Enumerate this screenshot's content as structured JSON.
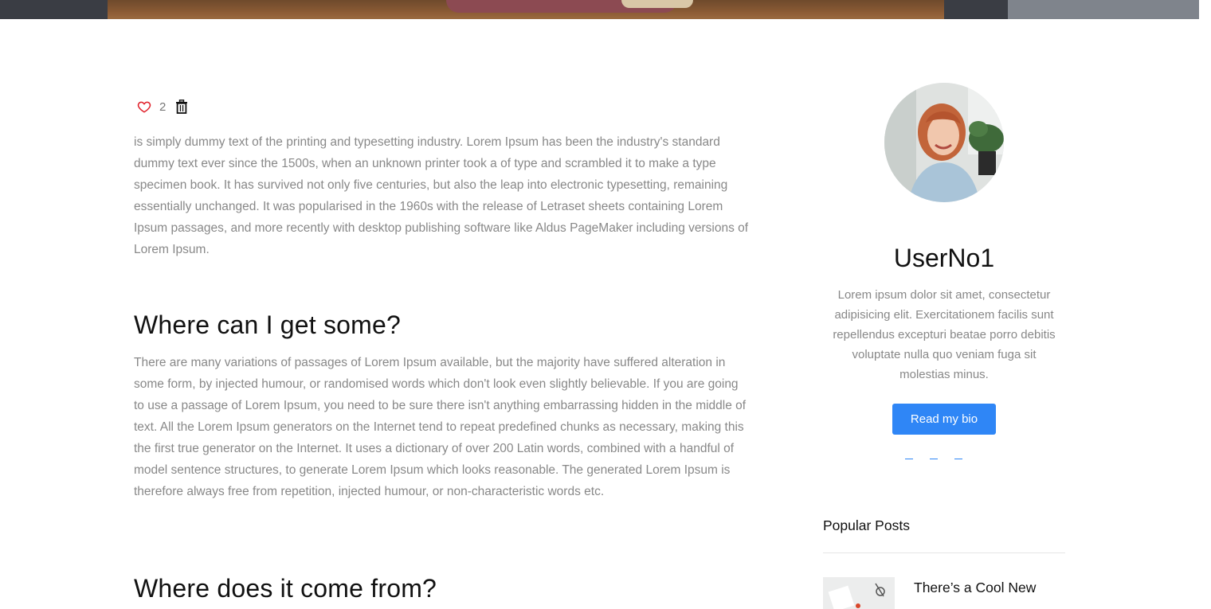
{
  "post": {
    "like_count": "2",
    "intro_paragraph": " is simply dummy text of the printing and typesetting industry. Lorem Ipsum has been the industry's standard dummy text ever since the 1500s, when an unknown printer took a of type and scrambled it to make a type specimen book. It has survived not only five centuries, but also the leap into electronic typesetting, remaining essentially unchanged. It was popularised in the 1960s with the release of Letraset sheets containing Lorem Ipsum passages, and more recently with desktop publishing software like Aldus PageMaker including versions of Lorem Ipsum.",
    "section1_heading": "Where can I get some?",
    "section1_paragraph": "There are many variations of passages of Lorem Ipsum available, but the majority have suffered alteration in some form, by injected humour, or randomised words which don't look even slightly believable. If you are going to use a passage of Lorem Ipsum, you need to be sure there isn't anything embarrassing hidden in the middle of text. All the Lorem Ipsum generators on the Internet tend to repeat predefined chunks as necessary, making this the first true generator on the Internet. It uses a dictionary of over 200 Latin words, combined with a handful of model sentence structures, to generate Lorem Ipsum which looks reasonable. The generated Lorem Ipsum is therefore always free from repetition, injected humour, or non-characteristic words etc.",
    "section2_heading": "Where does it come from?"
  },
  "sidebar": {
    "username": "UserNo1",
    "bio": "Lorem ipsum dolor sit amet, consectetur adipisicing elit. Exercitationem facilis sunt repellendus excepturi beatae porro debitis voluptate nulla quo veniam fuga sit molestias minus.",
    "bio_button_label": "Read my bio",
    "popular_posts_title": "Popular Posts",
    "popular_posts": [
      {
        "title": "There’s a Cool New"
      }
    ]
  },
  "colors": {
    "accent": "#2f86f6",
    "like": "#e0202a"
  }
}
